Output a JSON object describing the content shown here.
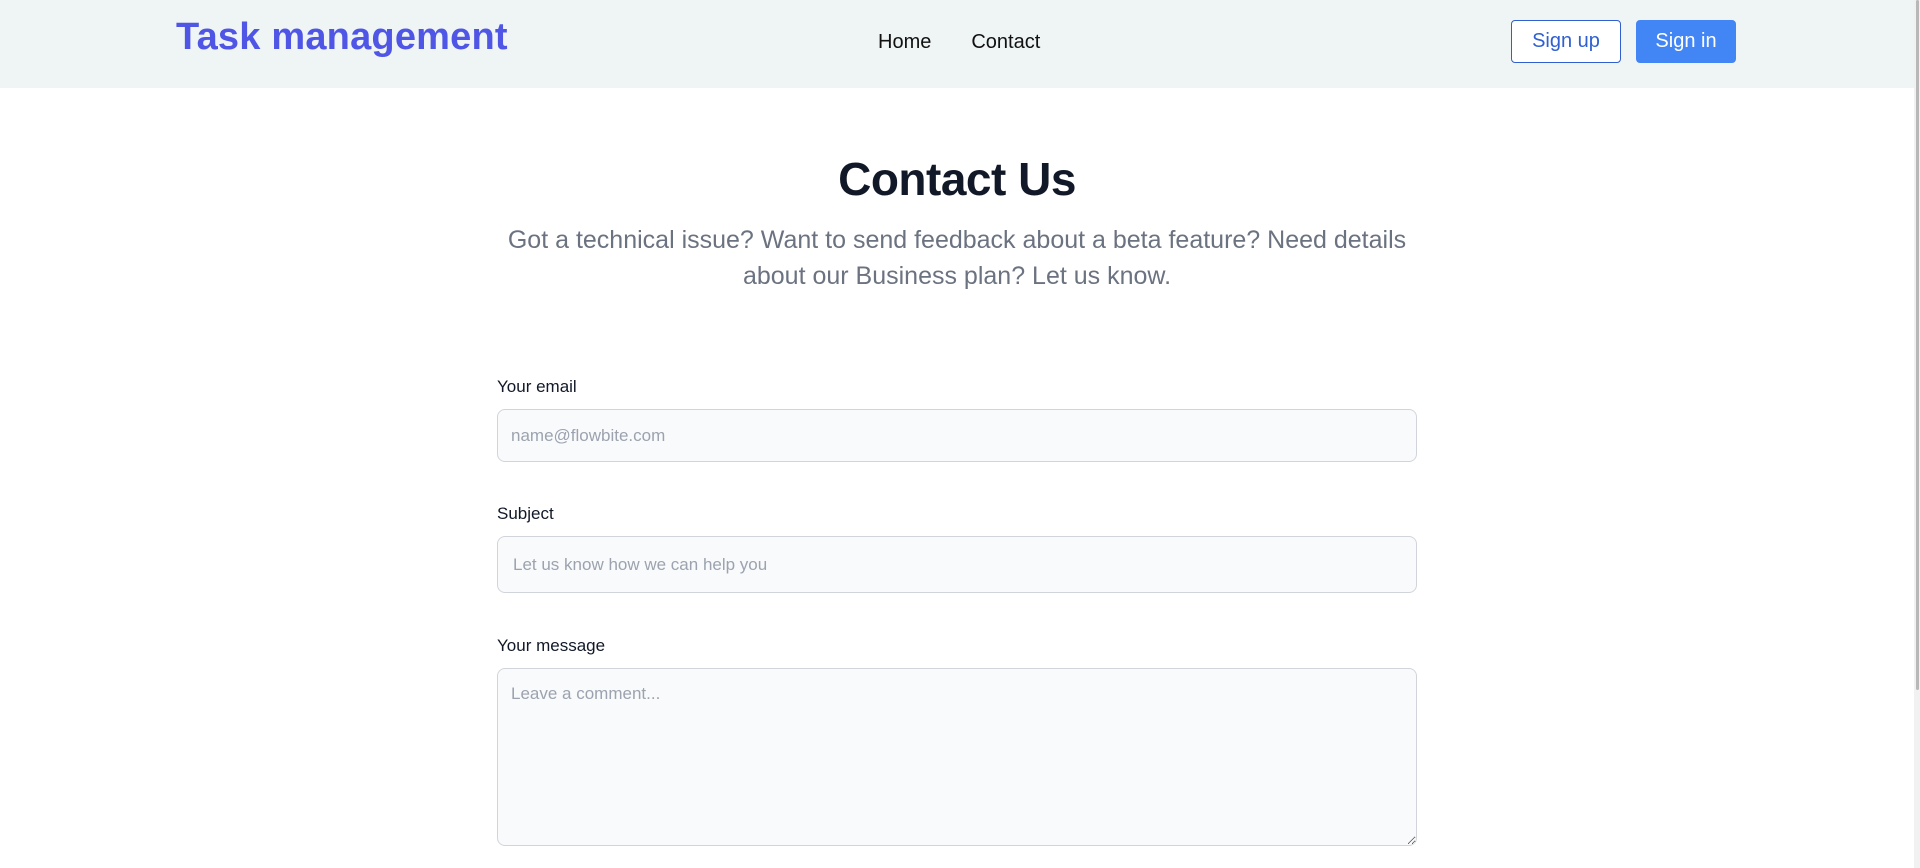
{
  "nav": {
    "brand": "Task management",
    "links": [
      {
        "label": "Home"
      },
      {
        "label": "Contact"
      }
    ],
    "signup_label": "Sign up",
    "signin_label": "Sign in"
  },
  "hero": {
    "title": "Contact Us",
    "subtitle": "Got a technical issue? Want to send feedback about a beta feature? Need details about our Business plan? Let us know."
  },
  "form": {
    "email": {
      "label": "Your email",
      "placeholder": "name@flowbite.com",
      "value": ""
    },
    "subject": {
      "label": "Subject",
      "placeholder": "Let us know how we can help you",
      "value": ""
    },
    "message": {
      "label": "Your message",
      "placeholder": "Leave a comment...",
      "value": ""
    }
  },
  "colors": {
    "brand": "#4f56e6",
    "primary_button": "#4285f4",
    "nav_background": "#eff4f4"
  }
}
